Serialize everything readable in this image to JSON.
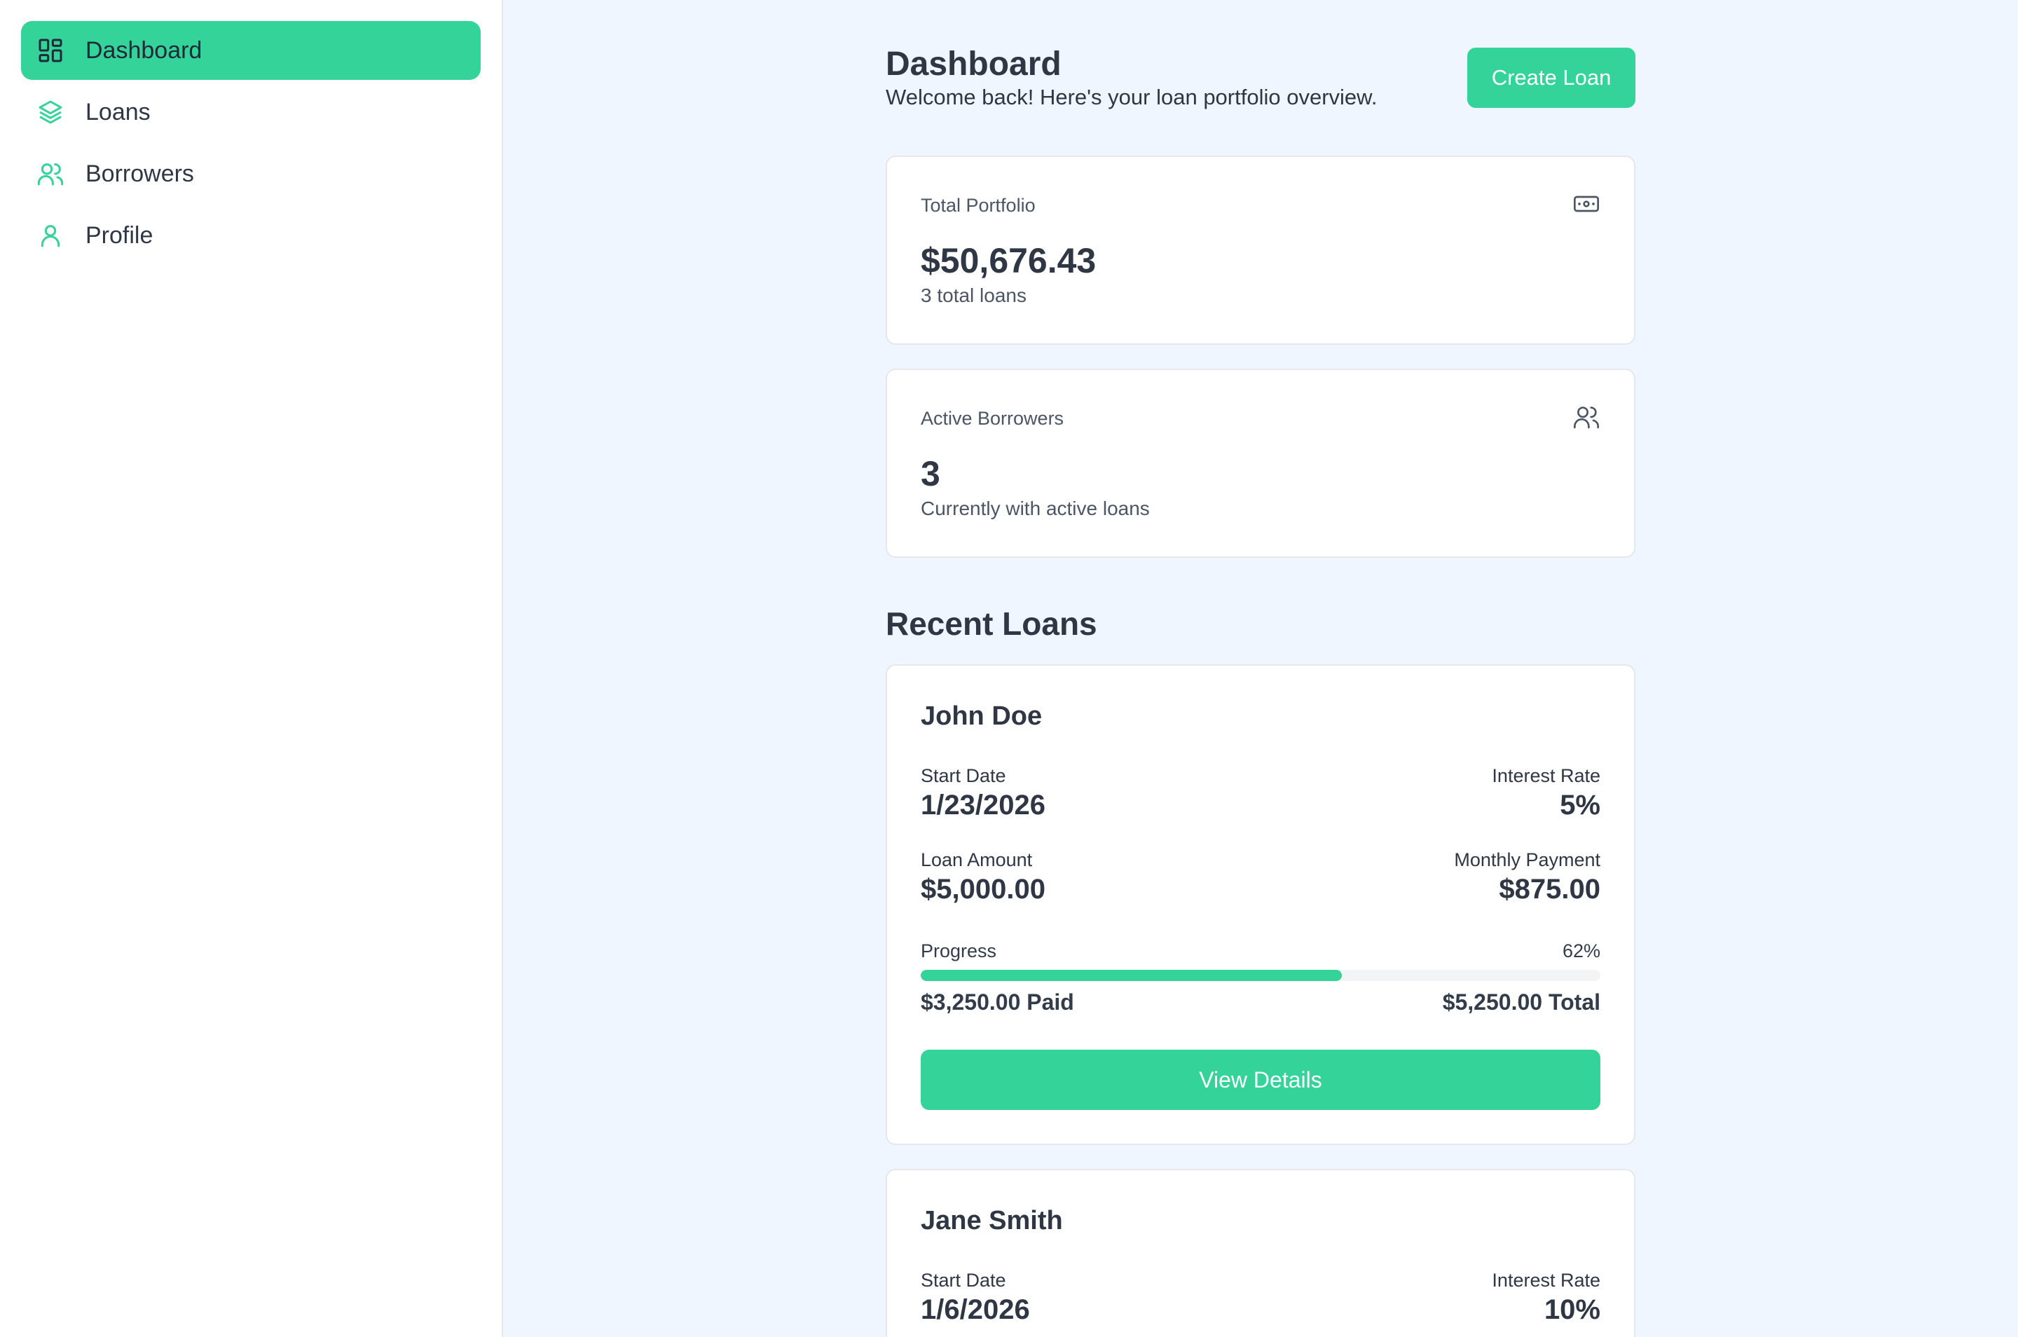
{
  "sidebar": {
    "items": [
      {
        "label": "Dashboard",
        "icon": "dashboard-icon",
        "active": true
      },
      {
        "label": "Loans",
        "icon": "layers-icon",
        "active": false
      },
      {
        "label": "Borrowers",
        "icon": "users-icon",
        "active": false
      },
      {
        "label": "Profile",
        "icon": "user-icon",
        "active": false
      }
    ]
  },
  "header": {
    "title": "Dashboard",
    "subtitle": "Welcome back! Here's your loan portfolio overview.",
    "create_label": "Create Loan"
  },
  "stats": [
    {
      "label": "Total Portfolio",
      "value": "$50,676.43",
      "desc": "3 total loans",
      "icon": "banknote-icon"
    },
    {
      "label": "Active Borrowers",
      "value": "3",
      "desc": "Currently with active loans",
      "icon": "users-icon"
    }
  ],
  "recent": {
    "title": "Recent Loans",
    "loans": [
      {
        "name": "John Doe",
        "start_label": "Start Date",
        "start_value": "1/23/2026",
        "rate_label": "Interest Rate",
        "rate_value": "5%",
        "amount_label": "Loan Amount",
        "amount_value": "$5,000.00",
        "payment_label": "Monthly Payment",
        "payment_value": "$875.00",
        "progress_label": "Progress",
        "progress_text": "62%",
        "progress": 0.62,
        "paid": "$3,250.00 Paid",
        "total": "$5,250.00 Total",
        "button_label": "View Details"
      },
      {
        "name": "Jane Smith",
        "start_label": "Start Date",
        "start_value": "1/6/2026",
        "rate_label": "Interest Rate",
        "rate_value": "10%"
      }
    ]
  },
  "colors": {
    "accent": "#34d399",
    "text": "#2f3744",
    "muted": "#4b5563",
    "bg": "#eff6ff"
  }
}
